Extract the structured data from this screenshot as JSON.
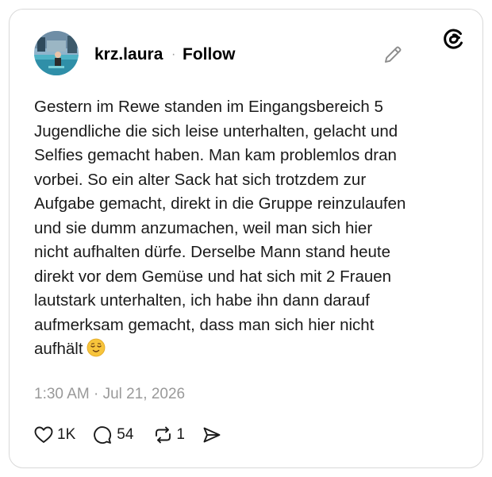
{
  "post": {
    "username": "krz.laura",
    "separator": "·",
    "follow_label": "Follow",
    "text": "Gestern im Rewe standen im Eingangsbereich 5\nJugendliche die sich leise unterhalten, gelacht und\nSelfies gemacht haben. Man kam problemlos dran\nvorbei. So ein alter Sack hat sich trotzdem zur\nAufgabe gemacht, direkt in die Gruppe reinzulaufen\nund sie dumm anzumachen, weil man sich hier\nnicht aufhalten dürfe. Derselbe Mann stand heute\ndirekt vor dem Gemüse und hat sich mit 2 Frauen\nlautstark unterhalten, ich habe ihn dann darauf\naufmerksam gemacht, dass man sich hier nicht\naufhält",
    "emoji": "relieved-face-emoji",
    "timestamp": "1:30 AM · Jul 21, 2026"
  },
  "actions": {
    "likes": "1K",
    "replies": "54",
    "reposts": "1"
  },
  "icons": {
    "brand": "threads-logo-icon",
    "edit": "pencil-icon",
    "like": "heart-icon",
    "reply": "speech-bubble-icon",
    "repost": "repost-arrows-icon",
    "share": "send-icon"
  },
  "colors": {
    "text": "#1a1a1a",
    "muted": "#999999",
    "border": "#d9d9d9",
    "emoji": "#f7c43b"
  }
}
